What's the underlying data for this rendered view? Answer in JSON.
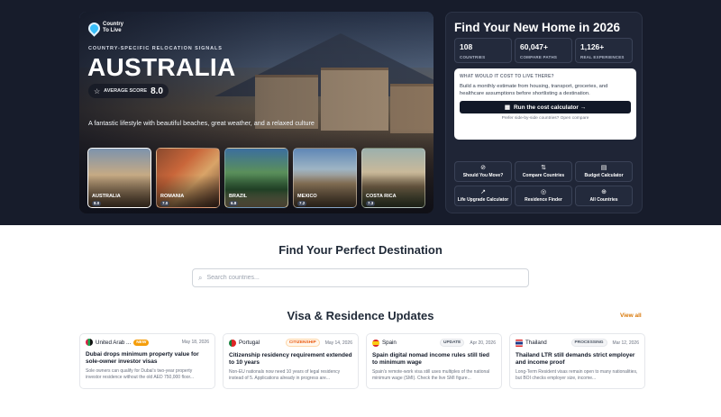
{
  "hero": {
    "logo_text": "Country To Live",
    "subtitle": "COUNTRY-SPECIFIC RELOCATION SIGNALS",
    "country": "AUSTRALIA",
    "score_label": "AVERAGE SCORE",
    "score_value": "8.0",
    "tagline": "A fantastic lifestyle with beautiful beaches, great weather, and a relaxed culture",
    "thumbs": [
      {
        "name": "AUSTRALIA",
        "score": "8.0"
      },
      {
        "name": "ROMANIA",
        "score": "7.0"
      },
      {
        "name": "BRAZIL",
        "score": "6.8"
      },
      {
        "name": "MEXICO",
        "score": "7.2"
      },
      {
        "name": "COSTA RICA",
        "score": "7.3"
      }
    ]
  },
  "panel": {
    "title": "Find Your New Home in 2026",
    "stats": [
      {
        "num": "108",
        "caption": "COUNTRIES"
      },
      {
        "num": "60,047+",
        "caption": "COMPARE PATHS"
      },
      {
        "num": "1,126+",
        "caption": "REAL EXPERIENCES"
      }
    ],
    "cost": {
      "question": "WHAT WOULD IT COST TO LIVE THERE?",
      "description": "Build a monthly estimate from housing, transport, groceries, and healthcare assumptions before shortlisting a destination.",
      "button": "Run the cost calculator →",
      "note": "Prefer side-by-side countries? Open compare"
    },
    "tools": [
      {
        "icon": "question-icon",
        "glyph": "⊘",
        "label": "Should You Move?"
      },
      {
        "icon": "compare-icon",
        "glyph": "⇅",
        "label": "Compare Countries"
      },
      {
        "icon": "calculator-icon",
        "glyph": "▤",
        "label": "Budget Calculator"
      },
      {
        "icon": "trend-icon",
        "glyph": "↗",
        "label": "Life Upgrade Calculator"
      },
      {
        "icon": "compass-icon",
        "glyph": "◎",
        "label": "Residence Finder"
      },
      {
        "icon": "globe-icon",
        "glyph": "⊕",
        "label": "All Countries"
      }
    ]
  },
  "destination": {
    "title": "Find Your Perfect Destination",
    "search_placeholder": "Search countries..."
  },
  "updates": {
    "title": "Visa & Residence Updates",
    "view_all": "View all",
    "cards": [
      {
        "country": "United Arab ...",
        "badge": "NEW",
        "date": "May 18, 2026",
        "headline": "Dubai drops minimum property value for sole-owner investor visas",
        "body": "Sole owners can qualify for Dubai's two-year property investor residence without the old AED 750,000 floor..."
      },
      {
        "country": "Portugal",
        "badge": "CITIZENSHIP",
        "date": "May 14, 2026",
        "headline": "Citizenship residency requirement extended to 10 years",
        "body": "Non-EU nationals now need 10 years of legal residency instead of 5. Applications already in progress are..."
      },
      {
        "country": "Spain",
        "badge": "UPDATE",
        "date": "Apr 20, 2026",
        "headline": "Spain digital nomad income rules still tied to minimum wage",
        "body": "Spain's remote-work visa still uses multiples of the national minimum wage (SMI). Check the live SMI figure..."
      },
      {
        "country": "Thailand",
        "badge": "PROCESSING",
        "date": "Mar 12, 2026",
        "headline": "Thailand LTR still demands strict employer and income proof",
        "body": "Long-Term Resident visas remain open to many nationalities, but BOI checks employer size, income..."
      }
    ]
  },
  "colors": {
    "dark_bg": "#171c2b",
    "accent_orange": "#d97706",
    "new_badge": "#f59e0b"
  }
}
